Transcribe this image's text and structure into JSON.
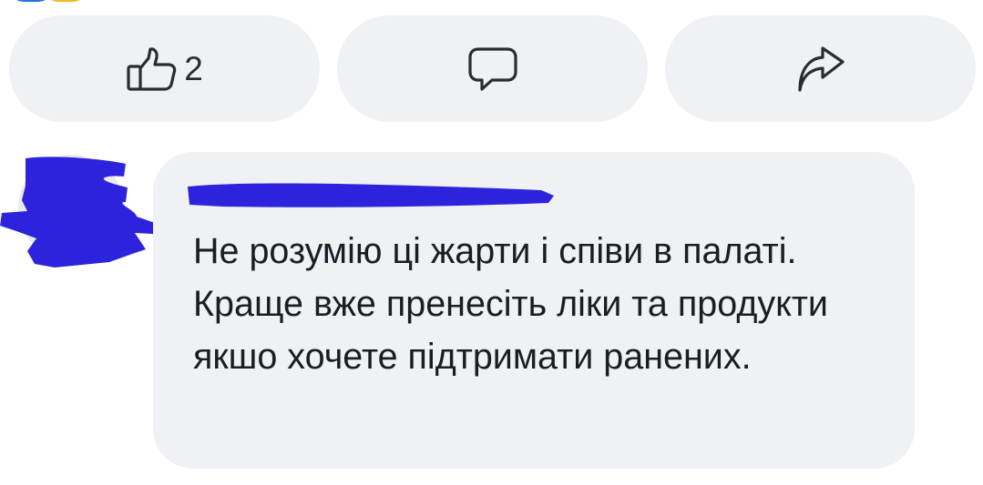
{
  "colors": {
    "button_bg": "#eff1f4",
    "bubble_bg": "#eff1f4",
    "text": "#1c1d21",
    "icon": "#2b2c30",
    "redaction": "#2e23dc"
  },
  "actions": {
    "like": {
      "icon": "thumbs-up-icon",
      "count": "2"
    },
    "comment": {
      "icon": "speech-bubble-icon"
    },
    "share": {
      "icon": "share-arrow-icon"
    }
  },
  "comment": {
    "author_avatar": "redacted",
    "author_name": "redacted",
    "text": "Не розумію ці жарти і співи в палаті. Краще вже пренесіть ліки та продукти якшо хочете підтримати ранених."
  }
}
